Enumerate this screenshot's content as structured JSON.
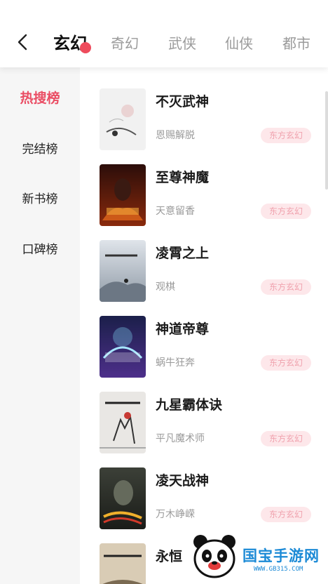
{
  "header": {
    "tabs": [
      {
        "label": "玄幻",
        "active": true
      },
      {
        "label": "奇幻",
        "active": false
      },
      {
        "label": "武侠",
        "active": false
      },
      {
        "label": "仙侠",
        "active": false
      },
      {
        "label": "都市",
        "active": false
      }
    ],
    "accent_color": "#ee4b5c"
  },
  "sidebar": {
    "items": [
      {
        "label": "热搜榜",
        "active": true
      },
      {
        "label": "完结榜",
        "active": false
      },
      {
        "label": "新书榜",
        "active": false
      },
      {
        "label": "口碑榜",
        "active": false
      }
    ],
    "active_color": "#ea4d64"
  },
  "books": [
    {
      "title": "不灭武神",
      "author": "恩赐解脱",
      "tag": "东方玄幻"
    },
    {
      "title": "至尊神魔",
      "author": "天意留香",
      "tag": "东方玄幻"
    },
    {
      "title": "凌霄之上",
      "author": "观棋",
      "tag": "东方玄幻"
    },
    {
      "title": "神道帝尊",
      "author": "蜗牛狂奔",
      "tag": "东方玄幻"
    },
    {
      "title": "九星霸体诀",
      "author": "平凡魔术师",
      "tag": "东方玄幻"
    },
    {
      "title": "凌天战神",
      "author": "万木峥嵘",
      "tag": "东方玄幻"
    },
    {
      "title": "永恒",
      "author": "",
      "tag": ""
    }
  ],
  "watermark": {
    "name": "国宝手游网",
    "url": "WWW.GB315.COM"
  }
}
